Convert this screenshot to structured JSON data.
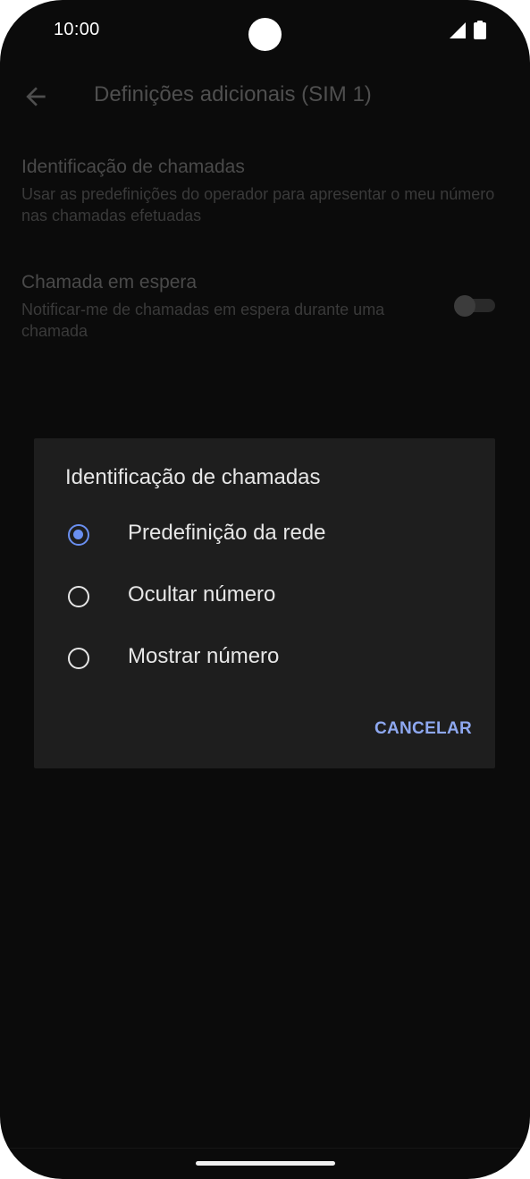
{
  "status_bar": {
    "time": "10:00",
    "icons": [
      "signal-icon",
      "battery-icon"
    ]
  },
  "header": {
    "title": "Definições adicionais (SIM 1)",
    "back_icon": "back-arrow-icon"
  },
  "settings": [
    {
      "title": "Identificação de chamadas",
      "summary": "Usar as predefinições do operador para apresentar o meu número nas chamadas efetuadas"
    },
    {
      "title": "Chamada em espera",
      "summary": "Notificar-me de chamadas em espera durante uma chamada",
      "toggle_on": false
    }
  ],
  "dialog": {
    "title": "Identificação de chamadas",
    "options": [
      {
        "label": "Predefinição da rede",
        "selected": true
      },
      {
        "label": "Ocultar número",
        "selected": false
      },
      {
        "label": "Mostrar número",
        "selected": false
      }
    ],
    "cancel_label": "CANCELAR"
  },
  "colors": {
    "background": "#0b0b0b",
    "dialog_background": "#1e1e1e",
    "accent": "#6a8ff0",
    "button_text": "#8ea8f0"
  }
}
